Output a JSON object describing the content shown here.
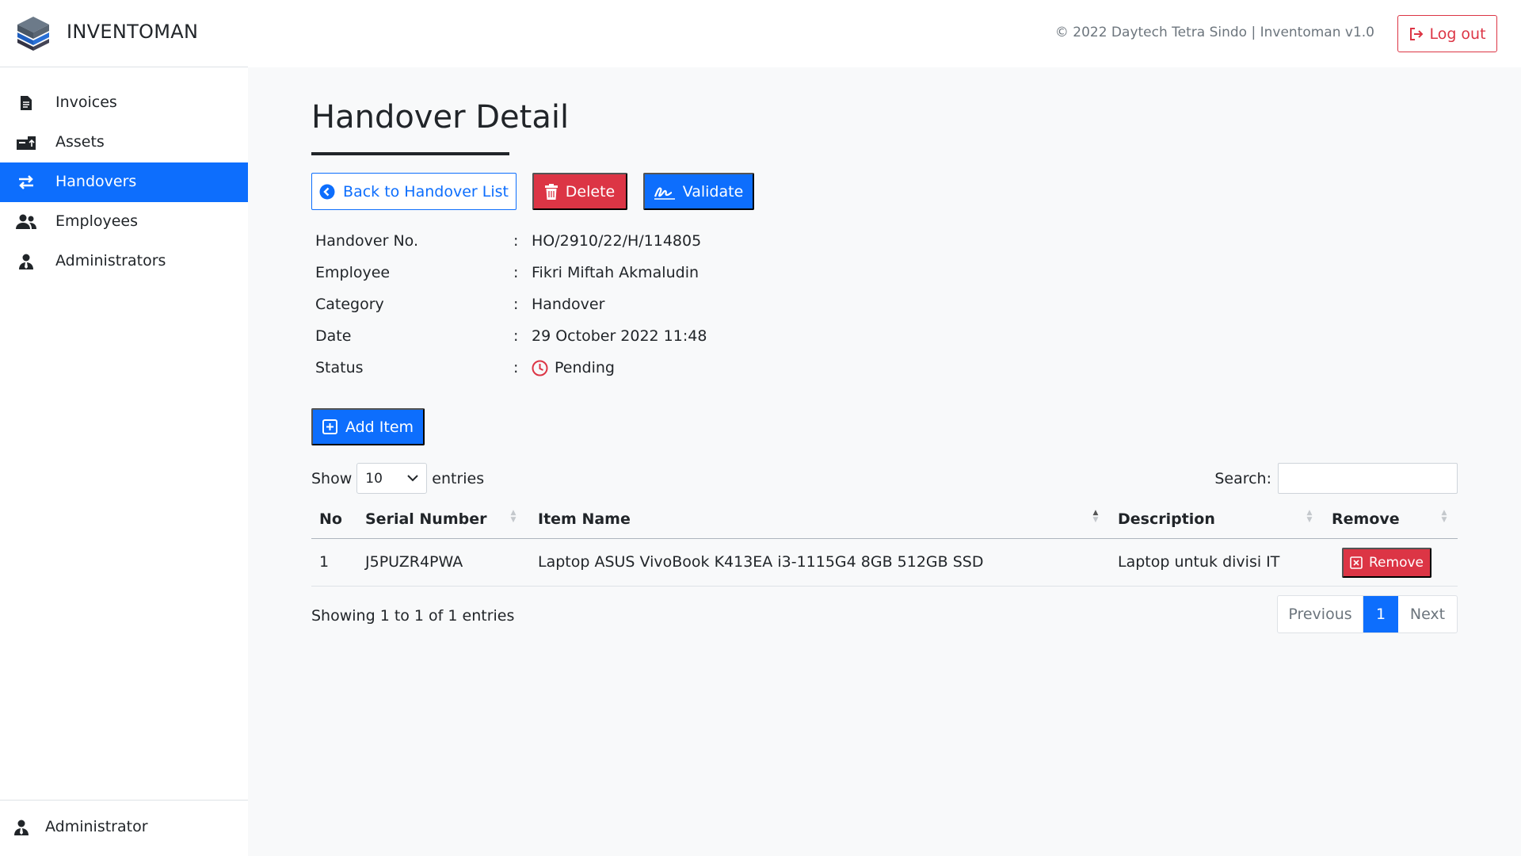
{
  "header": {
    "brand": "INVENTOMAN",
    "copyright": "© 2022 Daytech Tetra Sindo | Inventoman v1.0",
    "logout_label": "Log out"
  },
  "sidebar": {
    "items": [
      {
        "label": "Invoices",
        "icon": "invoice-icon",
        "active": false
      },
      {
        "label": "Assets",
        "icon": "assets-icon",
        "active": false
      },
      {
        "label": "Handovers",
        "icon": "exchange-icon",
        "active": true
      },
      {
        "label": "Employees",
        "icon": "users-icon",
        "active": false
      },
      {
        "label": "Administrators",
        "icon": "user-tie-icon",
        "active": false
      }
    ],
    "footer_user": "Administrator"
  },
  "main": {
    "title": "Handover Detail",
    "actions": {
      "back_label": "Back to Handover List",
      "delete_label": "Delete",
      "validate_label": "Validate"
    },
    "details": [
      {
        "key": "Handover No.",
        "value": "HO/2910/22/H/114805"
      },
      {
        "key": "Employee",
        "value": "Fikri Miftah Akmaludin"
      },
      {
        "key": "Category",
        "value": "Handover"
      },
      {
        "key": "Date",
        "value": "29 October 2022 11:48"
      },
      {
        "key": "Status",
        "value": "Pending"
      }
    ],
    "separator": ":",
    "add_item_label": "Add Item",
    "table_controls": {
      "show_label": "Show",
      "entries_label": "entries",
      "page_size": "10",
      "search_label": "Search:",
      "search_value": ""
    },
    "table": {
      "columns": [
        "No",
        "Serial Number",
        "Item Name",
        "Description",
        "Remove"
      ],
      "rows": [
        {
          "no": "1",
          "serial": "J5PUZR4PWA",
          "item": "Laptop ASUS VivoBook K413EA i3-1115G4 8GB 512GB SSD",
          "description": "Laptop untuk divisi IT",
          "remove_label": "Remove"
        }
      ]
    },
    "showing_text": "Showing 1 to 1 of 1 entries",
    "pagination": {
      "previous": "Previous",
      "page": "1",
      "next": "Next"
    }
  },
  "colors": {
    "primary": "#0d6efd",
    "danger": "#dc3545",
    "pending": "#dc3545"
  }
}
